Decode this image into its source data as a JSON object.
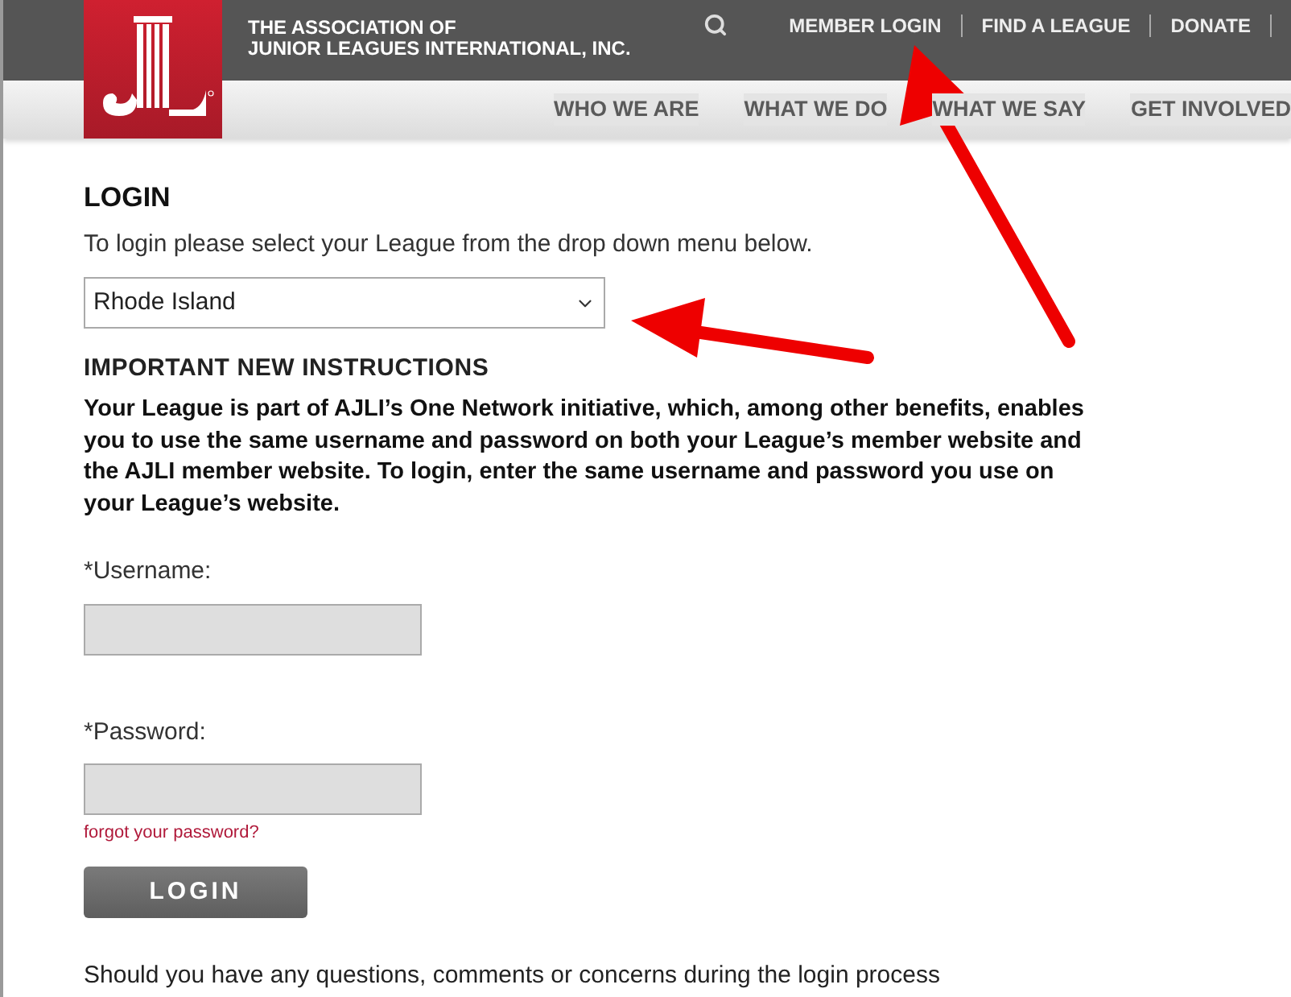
{
  "header": {
    "org_name": [
      "THE ASSOCIATION OF",
      "JUNIOR LEAGUES INTERNATIONAL, INC."
    ],
    "utility_links": [
      "MEMBER LOGIN",
      "FIND A LEAGUE",
      "DONATE"
    ],
    "nav": [
      "WHO WE ARE",
      "WHAT WE DO",
      "WHAT WE SAY",
      "GET INVOLVED"
    ]
  },
  "login": {
    "title": "LOGIN",
    "intro": "To login please select your League from the drop down menu below.",
    "league_select": {
      "value": "Rhode Island"
    },
    "instructions_title": "IMPORTANT NEW INSTRUCTIONS",
    "instructions": "Your League is part of AJLI’s One Network initiative, which, among other benefits, enables you to use the same username and password on both your League’s member website and the AJLI member website. To login, enter the same username and password you use on your League’s website.",
    "username_label": "*Username:",
    "password_label": "*Password:",
    "forgot_link": "forgot your password?",
    "submit": "LOGIN",
    "footer_text": "Should you have any questions, comments or concerns during the login process"
  }
}
